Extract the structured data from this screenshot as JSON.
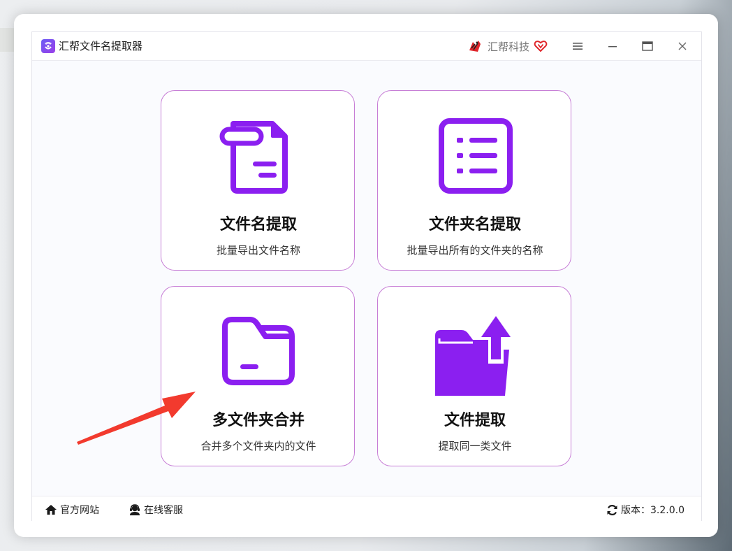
{
  "app": {
    "title": "汇帮文件名提取器",
    "brand_label": "汇帮科技"
  },
  "colors": {
    "accent": "#8b1ff0",
    "card_border": "#c77ed6",
    "arrow": "#f23a2e"
  },
  "cards": [
    {
      "title": "文件名提取",
      "desc": "批量导出文件名称",
      "icon": "file-icon"
    },
    {
      "title": "文件夹名提取",
      "desc": "批量导出所有的文件夹的名称",
      "icon": "list-icon"
    },
    {
      "title": "多文件夹合并",
      "desc": "合并多个文件夹内的文件",
      "icon": "folder-icon"
    },
    {
      "title": "文件提取",
      "desc": "提取同一类文件",
      "icon": "folder-upload-icon"
    }
  ],
  "statusbar": {
    "website": "官方网站",
    "support": "在线客服",
    "version": "版本：3.2.0.0"
  }
}
